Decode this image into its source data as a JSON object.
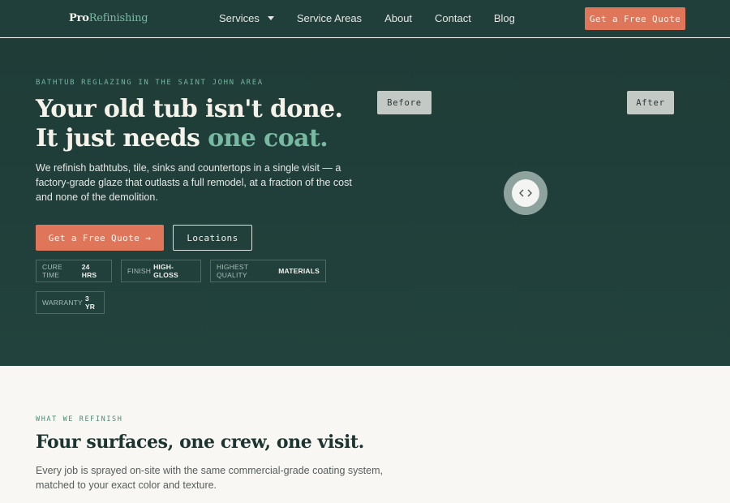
{
  "nav": {
    "logo_pro": "Pro",
    "logo_refinishing": "Refinishing",
    "links": [
      "Services",
      "Service Areas",
      "About",
      "Contact",
      "Blog"
    ],
    "cta": "Get a Free Quote"
  },
  "hero": {
    "eyebrow": "BATHTUB REGLAZING IN THE SAINT JOHN AREA",
    "headline_line1": "Your old tub isn't done.",
    "headline_line2_prefix": "It just needs ",
    "headline_line2_accent": "one coat.",
    "lede": "We refinish bathtubs, tile, sinks and countertops in a single visit — a factory-grade glaze that outlasts a full remodel, at a fraction of the cost and none of the demolition.",
    "primary_button": "Get a Free Quote →",
    "secondary_button": "Locations",
    "badges": [
      {
        "label": "CURE TIME",
        "value": "24 HRS"
      },
      {
        "label": "FINISH",
        "value": "HIGH-GLOSS"
      },
      {
        "label": "HIGHEST QUALITY",
        "value": "MATERIALS"
      },
      {
        "label": "WARRANTY",
        "value": "3 YR"
      }
    ],
    "before_label": "Before",
    "after_label": "After"
  },
  "section": {
    "eyebrow": "WHAT WE REFINISH",
    "title": "Four surfaces, one crew, one visit.",
    "body": "Every job is sprayed on-site with the same commercial-grade coating system, matched to your exact color and texture."
  },
  "colors": {
    "nav_bg": "#213f3a",
    "hero_bg": "#1f3c37",
    "accent_green": "#78b9a1",
    "cta_orange": "#df765a"
  },
  "icons": {
    "services_caret": "chevron-down-icon",
    "compare_handle": "chevron-left-right-icon"
  }
}
